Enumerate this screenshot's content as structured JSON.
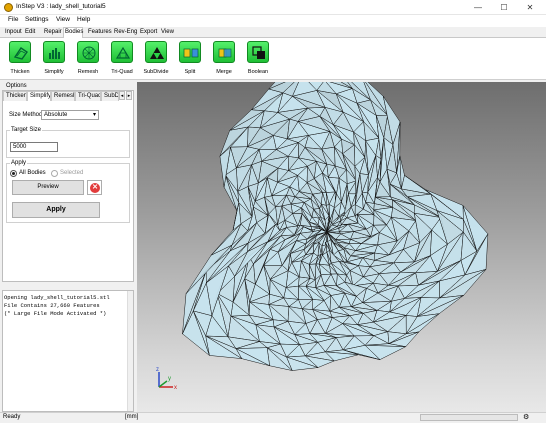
{
  "window": {
    "title": "InStep V3 : lady_shell_tutorial5",
    "minimize": "—",
    "maximize": "☐",
    "close": "✕"
  },
  "menu": [
    "File",
    "Settings",
    "View",
    "Help"
  ],
  "ribbon_tabs": [
    "Inpout",
    "Edit",
    "Repair",
    "Bodies",
    "Features",
    "Rev-Eng",
    "Export",
    "View"
  ],
  "active_ribbon_tab": "Bodies",
  "tools": [
    {
      "label": "Thicken",
      "icon": "thicken-icon"
    },
    {
      "label": "Simplify",
      "icon": "simplify-icon"
    },
    {
      "label": "Remesh",
      "icon": "remesh-icon"
    },
    {
      "label": "Tri-Quad",
      "icon": "tri-quad-icon"
    },
    {
      "label": "SubDivide",
      "icon": "subdivide-icon"
    },
    {
      "label": "Split",
      "icon": "split-icon"
    },
    {
      "label": "Merge",
      "icon": "merge-icon"
    },
    {
      "label": "Boolean",
      "icon": "boolean-icon"
    }
  ],
  "options": {
    "heading": "Options",
    "tabs": [
      "Thicken",
      "Simplify",
      "Remesh",
      "Tri-Quad",
      "SubD"
    ],
    "active_tab": "Simplify",
    "size_method_label": "Size Method",
    "size_method_value": "Absolute",
    "target_size_label": "Target Size",
    "target_size_value": "5000",
    "apply_group_label": "Apply",
    "radio_all_bodies": "All Bodies",
    "radio_selected": "Selected",
    "radio_all_bodies_checked": true,
    "preview_label": "Preview",
    "cancel_symbol": "✕",
    "apply_label": "Apply"
  },
  "console": {
    "lines": [
      "Opening lady_shell_tutorial5.stl",
      "File Contains 27,660 Features",
      "(* Large File Mode Activated *)"
    ]
  },
  "axes": {
    "x": "x",
    "y": "y",
    "z": "z"
  },
  "status": {
    "ready": "Ready",
    "units": "[mm]"
  },
  "colors": {
    "tool_green": "#2bd245",
    "mesh_fill": "#c7e4ef",
    "mesh_edge": "#111111"
  }
}
